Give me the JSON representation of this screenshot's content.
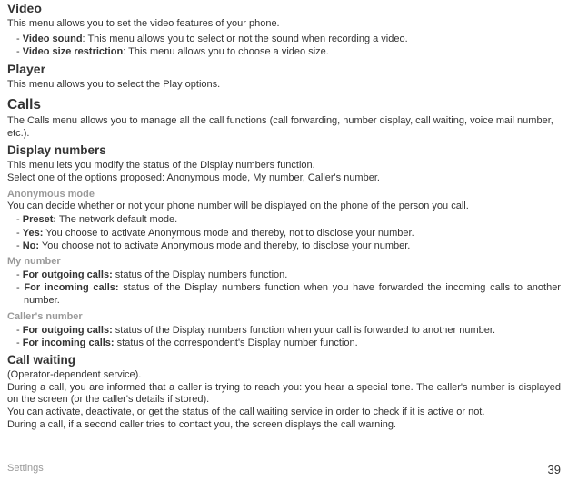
{
  "video": {
    "heading": "Video",
    "intro": "This menu allows you to set the video features of your phone.",
    "sound_label": "Video sound",
    "sound_desc": ": This menu allows you to select or not the sound when recording a video.",
    "size_label": "Video size restriction",
    "size_desc": ": This menu allows you to choose a video size."
  },
  "player": {
    "heading": "Player",
    "text": "This menu allows you to select the Play options."
  },
  "calls": {
    "heading": "Calls",
    "text": "The Calls menu allows you to manage all the call functions (call forwarding, number display, call waiting, voice mail number, etc.)."
  },
  "display_numbers": {
    "heading": "Display numbers",
    "line1": "This menu lets you modify the status of the Display numbers function.",
    "line2": "Select one of the options proposed: Anonymous mode, My number, Caller's number."
  },
  "anonymous": {
    "heading": "Anonymous mode",
    "intro": "You can decide whether or not your phone number will be displayed on the phone of the person you call.",
    "preset_label": "Preset:",
    "preset_desc": " The network default mode.",
    "yes_label": "Yes:",
    "yes_desc": " You choose to activate Anonymous mode and thereby, not to disclose your number.",
    "no_label": "No:",
    "no_desc": " You choose not to activate Anonymous mode and thereby, to disclose your number."
  },
  "my_number": {
    "heading": "My number",
    "out_label": "For outgoing calls:",
    "out_desc": " status of the Display numbers function.",
    "in_label": "For incoming calls:",
    "in_desc": " status of the Display numbers function when you have forwarded the incoming calls to another number."
  },
  "callers_number": {
    "heading": "Caller's number",
    "out_label": "For outgoing calls:",
    "out_desc": " status of the Display numbers function when your call is forwarded to another number.",
    "in_label": "For incoming calls:",
    "in_desc": " status of the correspondent's Display number function."
  },
  "call_waiting": {
    "heading": "Call waiting",
    "line1": "(Operator-dependent service).",
    "line2": "During a call, you are informed that a caller is trying to reach you: you hear a special tone. The caller's number is displayed on the screen (or the caller's details if stored).",
    "line3": "You can activate, deactivate, or get the status of the call waiting service in order to check if it is active or not.",
    "line4": "During a call, if a second caller tries to contact you, the screen displays the call warning."
  },
  "footer": {
    "section": "Settings",
    "page": "39"
  }
}
